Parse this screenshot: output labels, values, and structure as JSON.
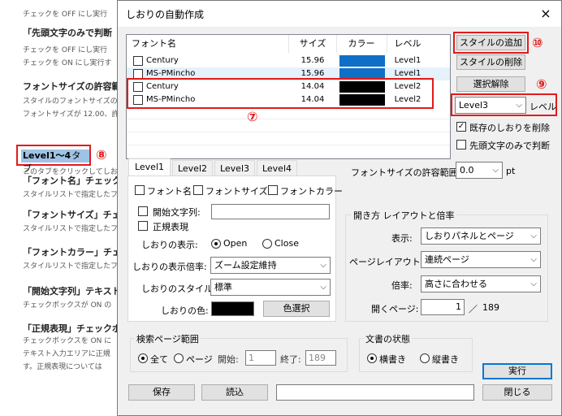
{
  "background_doc": {
    "lines": [
      {
        "kind": "text",
        "text": "チェックを OFF にし実行"
      },
      {
        "kind": "head",
        "text": "「先頭文字のみで判断"
      },
      {
        "kind": "text",
        "text": "チェックを OFF にし実行"
      },
      {
        "kind": "text",
        "text": "チェックを ON にし実行す"
      },
      {
        "kind": "head",
        "text": "フォントサイズの許容範"
      },
      {
        "kind": "text",
        "text": "スタイルのフォントサイズの"
      },
      {
        "kind": "text",
        "text": "フォントサイズが 12.00、許"
      },
      {
        "kind": "text",
        "text": "このタブをクリックしてしお"
      },
      {
        "kind": "head",
        "text": "「フォント名」チェックボ"
      },
      {
        "kind": "text",
        "text": "スタイルリストで指定したフ"
      },
      {
        "kind": "head",
        "text": "「フォントサイズ」チェッ"
      },
      {
        "kind": "text",
        "text": "スタイルリストで指定したフ"
      },
      {
        "kind": "head",
        "text": "「フォントカラー」チェッ"
      },
      {
        "kind": "text",
        "text": "スタイルリストで指定したフ"
      },
      {
        "kind": "head",
        "text": "「開始文字列」テキスト"
      },
      {
        "kind": "text",
        "text": "チェックボックスが ON の"
      },
      {
        "kind": "head",
        "text": "「正規表現」チェックボ"
      },
      {
        "kind": "text",
        "text": "チェックボックスを ON に"
      },
      {
        "kind": "text",
        "text": "テキスト入力エリアに正規"
      },
      {
        "kind": "text",
        "text": "す。正規表現については"
      }
    ],
    "level_tab_label": "Level1～4",
    "level_tab_suffix": "タブ",
    "marker_8": "⑧"
  },
  "dialog": {
    "title": "しおりの自動作成",
    "close_icon": "×",
    "table": {
      "headers": [
        "フォント名",
        "サイズ",
        "カラー",
        "レベル"
      ],
      "rows": [
        {
          "font": "Century",
          "size": "15.96",
          "color": "#0f6fc6",
          "level": "Level1"
        },
        {
          "font": "MS-PMincho",
          "size": "15.96",
          "color": "#0f6fc6",
          "level": "Level1"
        },
        {
          "font": "Century",
          "size": "14.04",
          "color": "#000000",
          "level": "Level2"
        },
        {
          "font": "MS-PMincho",
          "size": "14.04",
          "color": "#000000",
          "level": "Level2"
        }
      ],
      "marker_7": "⑦"
    },
    "right": {
      "add_style": "スタイルの追加",
      "delete_style": "スタイルの削除",
      "clear_selection": "選択解除",
      "marker_9": "⑨",
      "marker_10": "⑩",
      "level_select": "Level3",
      "level_label": "レベル",
      "delete_existing": "既存のしおりを削除",
      "first_char_only": "先頭文字のみで判断"
    },
    "tabs": [
      "Level1",
      "Level2",
      "Level3",
      "Level4"
    ],
    "level_panel": {
      "font_name": "フォント名",
      "font_size": "フォントサイズ",
      "font_color": "フォントカラー",
      "start_string": "開始文字列:",
      "regex": "正規表現",
      "display_label": "しおりの表示:",
      "open": "Open",
      "close": "Close",
      "zoom_label": "しおりの表示倍率:",
      "zoom_value": "ズーム設定維持",
      "style_label": "しおりのスタイル:",
      "style_value": "標準",
      "color_label": "しおりの色:",
      "color_value": "#000000",
      "color_button": "色選択"
    },
    "tolerance": {
      "label": "フォントサイズの許容範囲:",
      "value": "0.0",
      "unit": "pt"
    },
    "open_group": {
      "title": "開き方  レイアウトと倍率",
      "display_label": "表示:",
      "display_value": "しおりパネルとページ",
      "layout_label": "ページレイアウト:",
      "layout_value": "連続ページ",
      "zoom_label": "倍率:",
      "zoom_value": "高さに合わせる",
      "open_page_label": "開くページ:",
      "open_page_value": "1",
      "page_sep": "／",
      "page_total": "189"
    },
    "search_group": {
      "title": "検索ページ範囲",
      "all": "全て",
      "page": "ページ",
      "start_label": "開始:",
      "start_value": "1",
      "end_label": "終了:",
      "end_value": "189"
    },
    "doc_state": {
      "title": "文書の状態",
      "horizontal": "横書き",
      "vertical": "縦書き"
    },
    "buttons": {
      "run": "実行",
      "save": "保存",
      "load": "読込",
      "close": "閉じる"
    }
  }
}
